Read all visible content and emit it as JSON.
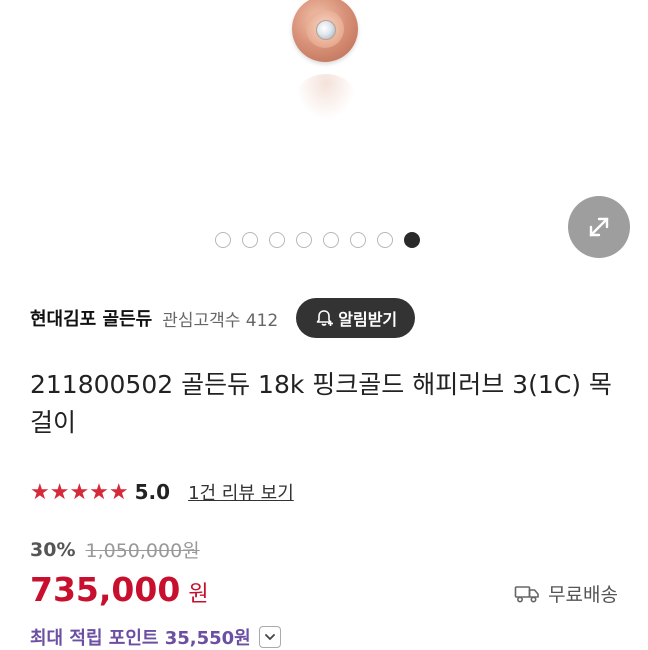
{
  "gallery": {
    "dot_count": 8,
    "active_dot_index": 7
  },
  "seller": {
    "name": "현대김포 골든듀",
    "interest_label": "관심고객수 412",
    "alarm_button_label": "알림받기"
  },
  "product": {
    "title": "211800502 골든듀 18k 핑크골드 해피러브 3(1C) 목걸이"
  },
  "rating": {
    "stars": 5,
    "score": "5.0",
    "review_link": "1건 리뷰 보기"
  },
  "pricing": {
    "discount": "30%",
    "original_price": "1,050,000원",
    "price": "735,000",
    "currency": "원",
    "delivery": "무료배송",
    "points": "최대 적립 포인트 35,550원"
  },
  "colors": {
    "price": "#c8102e",
    "star": "#d42a3a",
    "points": "#6b4fa3"
  }
}
